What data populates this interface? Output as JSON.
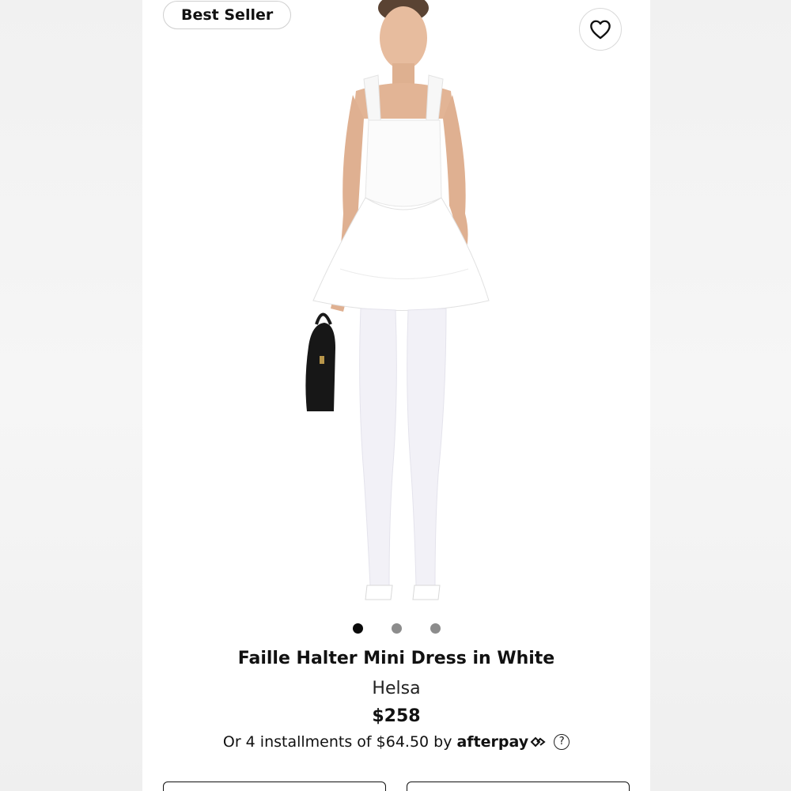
{
  "badge": {
    "label": "Best Seller"
  },
  "product": {
    "title": "Faille Halter Mini Dress in White",
    "brand": "Helsa",
    "price": "$258",
    "installments_text": "Or 4 installments of $64.50 by",
    "afterpay_label": "afterpay",
    "help_symbol": "?"
  },
  "carousel": {
    "total": 3,
    "active_index": 1
  },
  "icons": {
    "favorite": "heart-icon",
    "afterpay_logo": "afterpay-arrows-icon",
    "help": "question-circle-icon"
  },
  "colors": {
    "dot_active": "#0a0a0a",
    "dot_inactive": "#8c8c8c",
    "text": "#111111"
  }
}
